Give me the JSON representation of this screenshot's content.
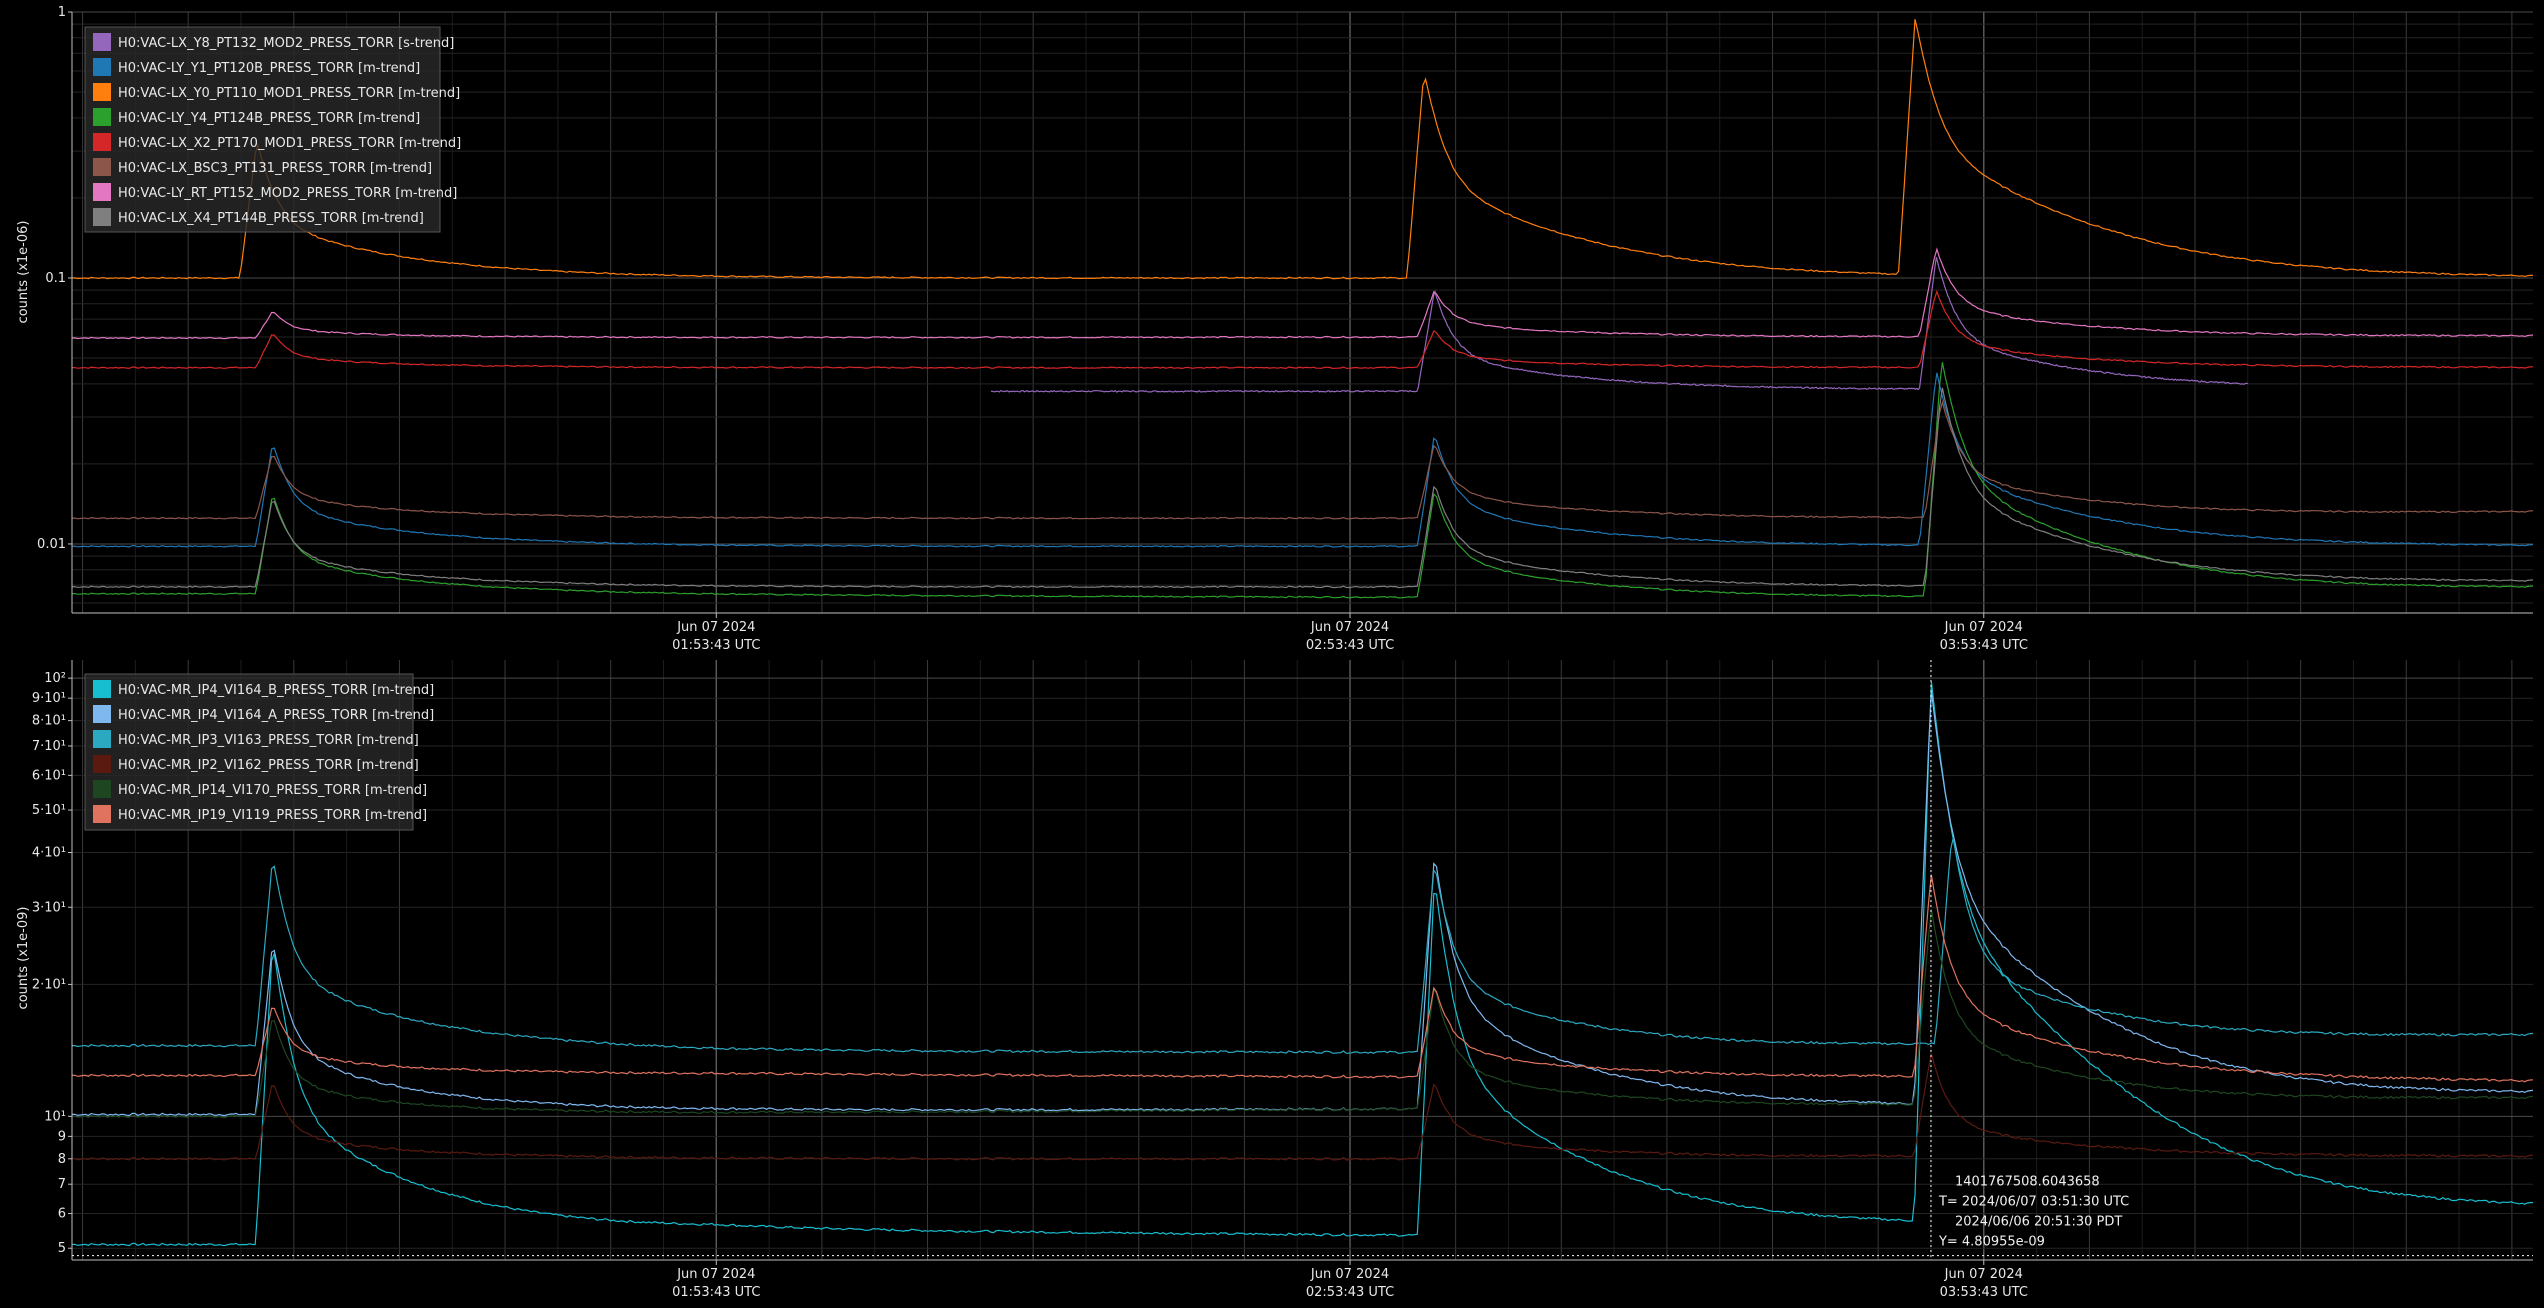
{
  "chart_data": [
    {
      "type": "line",
      "ylabel": "counts (x1e-06)",
      "yscale": "log",
      "ylim": [
        0.0055,
        1.0
      ],
      "ytick_labels": [
        {
          "value": 1,
          "label": "1"
        },
        {
          "value": 0.1,
          "label": "0.1"
        },
        {
          "value": 0.01,
          "label": "0.01"
        }
      ],
      "x_ticks": [
        {
          "t": 60,
          "date": "Jun 07 2024",
          "time": "01:53:43 UTC"
        },
        {
          "t": 120,
          "date": "Jun 07 2024",
          "time": "02:53:43 UTC"
        },
        {
          "t": 180,
          "date": "Jun 07 2024",
          "time": "03:53:43 UTC"
        }
      ],
      "xlim": [
        -1,
        232
      ],
      "grid": true,
      "legend_position": "top-left",
      "series": [
        {
          "name": "H0:VAC-LX_Y8_PT132_MOD2_PRESS_TORR [s-trend]",
          "color": "#9467bd",
          "segment": [
            86,
            205
          ],
          "baseline": [
            [
              86,
              0.0375
            ],
            [
              120,
              0.0375
            ],
            [
              178,
              0.038
            ],
            [
              205,
              0.038
            ]
          ],
          "spikes": [
            {
              "t": 128,
              "peak": 0.09
            },
            {
              "t": 175.5,
              "peak": 0.12
            }
          ]
        },
        {
          "name": "H0:VAC-LY_Y1_PT120B_PRESS_TORR [m-trend]",
          "color": "#1f77b4",
          "baseline": [
            [
              -1,
              0.0098
            ],
            [
              16,
              0.0098
            ],
            [
              127,
              0.0098
            ],
            [
              174,
              0.0098
            ],
            [
              232,
              0.0098
            ]
          ],
          "spikes": [
            {
              "t": 18,
              "peak": 0.024
            },
            {
              "t": 128,
              "peak": 0.026
            },
            {
              "t": 175.5,
              "peak": 0.045
            }
          ]
        },
        {
          "name": "H0:VAC-LX_Y0_PT110_MOD1_PRESS_TORR [m-trend]",
          "color": "#ff7f0e",
          "baseline": [
            [
              -1,
              0.1
            ],
            [
              16,
              0.1
            ],
            [
              127,
              0.1
            ],
            [
              174,
              0.1
            ],
            [
              232,
              0.1
            ]
          ],
          "spikes": [
            {
              "t": 16.5,
              "peak": 0.33
            },
            {
              "t": 127,
              "peak": 0.6
            },
            {
              "t": 173.5,
              "peak": 0.95
            }
          ]
        },
        {
          "name": "H0:VAC-LY_Y4_PT124B_PRESS_TORR [m-trend]",
          "color": "#2ca02c",
          "baseline": [
            [
              -1,
              0.0065
            ],
            [
              16,
              0.0065
            ],
            [
              127,
              0.0063
            ],
            [
              174,
              0.0063
            ],
            [
              232,
              0.0068
            ]
          ],
          "spikes": [
            {
              "t": 18,
              "peak": 0.0155
            },
            {
              "t": 128,
              "peak": 0.016
            },
            {
              "t": 176,
              "peak": 0.05
            }
          ]
        },
        {
          "name": "H0:VAC-LX_X2_PT170_MOD1_PRESS_TORR [m-trend]",
          "color": "#d62728",
          "baseline": [
            [
              -1,
              0.046
            ],
            [
              16,
              0.046
            ],
            [
              127,
              0.046
            ],
            [
              174,
              0.046
            ],
            [
              232,
              0.046
            ]
          ],
          "spikes": [
            {
              "t": 18,
              "peak": 0.062
            },
            {
              "t": 128,
              "peak": 0.064
            },
            {
              "t": 175.5,
              "peak": 0.09
            }
          ]
        },
        {
          "name": "H0:VAC-LX_BSC3_PT131_PRESS_TORR [m-trend]",
          "color": "#8c564b",
          "baseline": [
            [
              -1,
              0.0125
            ],
            [
              16,
              0.0125
            ],
            [
              127,
              0.0125
            ],
            [
              174,
              0.0125
            ],
            [
              232,
              0.0132
            ]
          ],
          "spikes": [
            {
              "t": 18,
              "peak": 0.022
            },
            {
              "t": 128,
              "peak": 0.024
            },
            {
              "t": 176,
              "peak": 0.035
            }
          ]
        },
        {
          "name": "H0:VAC-LY_RT_PT152_MOD2_PRESS_TORR [m-trend]",
          "color": "#e377c2",
          "baseline": [
            [
              -1,
              0.0595
            ],
            [
              16,
              0.0595
            ],
            [
              127,
              0.06
            ],
            [
              174,
              0.06
            ],
            [
              232,
              0.0605
            ]
          ],
          "spikes": [
            {
              "t": 18,
              "peak": 0.075
            },
            {
              "t": 128,
              "peak": 0.09
            },
            {
              "t": 175.5,
              "peak": 0.13
            }
          ]
        },
        {
          "name": "H0:VAC-LX_X4_PT144B_PRESS_TORR [m-trend]",
          "color": "#7f7f7f",
          "baseline": [
            [
              -1,
              0.0069
            ],
            [
              16,
              0.0069
            ],
            [
              127,
              0.0069
            ],
            [
              174,
              0.0069
            ],
            [
              232,
              0.0072
            ]
          ],
          "spikes": [
            {
              "t": 18,
              "peak": 0.015
            },
            {
              "t": 128,
              "peak": 0.017
            },
            {
              "t": 176,
              "peak": 0.04
            }
          ]
        }
      ]
    },
    {
      "type": "line",
      "ylabel": "counts (x1e-09)",
      "yscale": "log",
      "ylim": [
        4.7,
        110
      ],
      "ytick_labels": [
        {
          "value": 100,
          "label": "10²"
        },
        {
          "value": 90,
          "label": "9·10¹"
        },
        {
          "value": 80,
          "label": "8·10¹"
        },
        {
          "value": 70,
          "label": "7·10¹"
        },
        {
          "value": 60,
          "label": "6·10¹"
        },
        {
          "value": 50,
          "label": "5·10¹"
        },
        {
          "value": 40,
          "label": "4·10¹"
        },
        {
          "value": 30,
          "label": "3·10¹"
        },
        {
          "value": 20,
          "label": "2·10¹"
        },
        {
          "value": 10,
          "label": "10¹"
        },
        {
          "value": 9,
          "label": "9"
        },
        {
          "value": 8,
          "label": "8"
        },
        {
          "value": 7,
          "label": "7"
        },
        {
          "value": 6,
          "label": "6"
        },
        {
          "value": 5,
          "label": "5"
        }
      ],
      "x_ticks": [
        {
          "t": 60,
          "date": "Jun 07 2024",
          "time": "01:53:43 UTC"
        },
        {
          "t": 120,
          "date": "Jun 07 2024",
          "time": "02:53:43 UTC"
        },
        {
          "t": 180,
          "date": "Jun 07 2024",
          "time": "03:53:43 UTC"
        }
      ],
      "xlim": [
        -1,
        232
      ],
      "grid": true,
      "legend_position": "top-left",
      "series": [
        {
          "name": "H0:VAC-MR_IP4_VI164_B_PRESS_TORR [m-trend]",
          "color": "#17becf",
          "baseline": [
            [
              -1,
              5.1
            ],
            [
              16,
              5.1
            ],
            [
              60,
              5.5
            ],
            [
              127,
              5.35
            ],
            [
              174,
              5.6
            ],
            [
              232,
              6.1
            ]
          ],
          "spikes": [
            {
              "t": 18,
              "peak": 25
            },
            {
              "t": 128,
              "peak": 35
            },
            {
              "t": 175,
              "peak": 100
            }
          ]
        },
        {
          "name": "H0:VAC-MR_IP4_VI164_A_PRESS_TORR [m-trend]",
          "color": "#7fb8ef",
          "baseline": [
            [
              -1,
              10.1
            ],
            [
              16,
              10.1
            ],
            [
              60,
              10.3
            ],
            [
              127,
              10.4
            ],
            [
              174,
              10.5
            ],
            [
              232,
              11.2
            ]
          ],
          "spikes": [
            {
              "t": 18,
              "peak": 25
            },
            {
              "t": 128,
              "peak": 40
            },
            {
              "t": 175,
              "peak": 95
            }
          ]
        },
        {
          "name": "H0:VAC-MR_IP3_VI163_PRESS_TORR [m-trend]",
          "color": "#2ba9c0",
          "baseline": [
            [
              -1,
              14.5
            ],
            [
              16,
              14.5
            ],
            [
              60,
              14.1
            ],
            [
              127,
              14
            ],
            [
              174,
              14.5
            ],
            [
              232,
              15.3
            ]
          ],
          "spikes": [
            {
              "t": 18,
              "peak": 39
            },
            {
              "t": 128,
              "peak": 38
            },
            {
              "t": 177,
              "peak": 45
            }
          ]
        },
        {
          "name": "H0:VAC-MR_IP2_VI162_PRESS_TORR [m-trend]",
          "color": "#5a1a10",
          "baseline": [
            [
              -1,
              8
            ],
            [
              16,
              8
            ],
            [
              127,
              8
            ],
            [
              174,
              8.1
            ],
            [
              232,
              8.1
            ]
          ],
          "spikes": [
            {
              "t": 18,
              "peak": 12
            },
            {
              "t": 128,
              "peak": 12
            },
            {
              "t": 175,
              "peak": 14
            }
          ]
        },
        {
          "name": "H0:VAC-MR_IP14_VI170_PRESS_TORR [m-trend]",
          "color": "#1e4620",
          "baseline": [
            [
              -1,
              10
            ],
            [
              16,
              10
            ],
            [
              127,
              10.4
            ],
            [
              174,
              10.6
            ],
            [
              232,
              11
            ]
          ],
          "spikes": [
            {
              "t": 18,
              "peak": 17
            },
            {
              "t": 128,
              "peak": 20
            },
            {
              "t": 175,
              "peak": 30
            }
          ]
        },
        {
          "name": "H0:VAC-MR_IP19_VI119_PRESS_TORR [m-trend]",
          "color": "#e0735f",
          "baseline": [
            [
              -1,
              12.4
            ],
            [
              16,
              12.4
            ],
            [
              60,
              12.5
            ],
            [
              127,
              12.3
            ],
            [
              174,
              12.3
            ],
            [
              232,
              12
            ]
          ],
          "spikes": [
            {
              "t": 18,
              "peak": 18
            },
            {
              "t": 128,
              "peak": 20
            },
            {
              "t": 175,
              "peak": 36
            }
          ]
        }
      ],
      "cursor": {
        "t": 175,
        "y_value": 4.80955,
        "gps_label": "1401767508.6043658",
        "utc_label": "T= 2024/06/07 03:51:30 UTC",
        "pdt_label": "2024/06/06 20:51:30 PDT",
        "y_label": "Y= 4.80955e-09"
      }
    }
  ]
}
